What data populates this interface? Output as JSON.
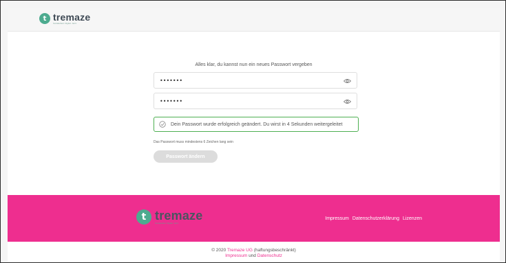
{
  "header": {
    "brand": "tremaze",
    "tagline": "Sozialarbeit. Digital. Jetzt."
  },
  "main": {
    "instruction": "Alles klar, du kannst nun ein neues Passwort vergeben",
    "password_1": "•••••••",
    "password_2": "•••••••",
    "success_message": "Dein Passwort wurde erfolgreich geändert. Du wirst in 4 Sekunden weitergeleitet",
    "hint": "Das Passwort muss mindestens 6 Zeichen lang sein",
    "submit_label": "Passwort ändern"
  },
  "footer": {
    "brand": "tremaze",
    "tagline": "Sozialarbeit. Digital. Jetzt.",
    "links": [
      "Impressum",
      "Datenschutzerklärung",
      "Lizenzen"
    ]
  },
  "copyright": {
    "prefix": "© 2020 ",
    "company": "Tremaze UG",
    "suffix": " (haftungsbeschränkt)",
    "link_impressum": "Impressum",
    "connector": " und ",
    "link_datenschutz": "Datenschutz"
  },
  "colors": {
    "brand_green": "#4dab8f",
    "footer_pink": "#ee2e8f",
    "success_border": "#4caf50"
  },
  "icons": [
    "logo-mark-icon",
    "eye-icon",
    "check-circle-icon"
  ]
}
